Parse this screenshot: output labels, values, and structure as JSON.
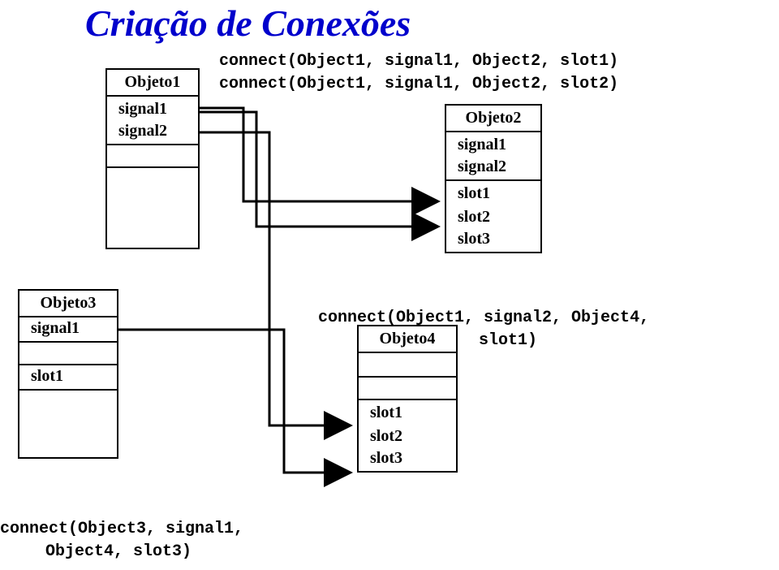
{
  "title": "Criação de Conexões",
  "code": {
    "conn1": "connect(Object1, signal1, Object2, slot1)",
    "conn2": "connect(Object1, signal1, Object2, slot2)",
    "conn3a": "connect(Object1, signal2, Object4,",
    "conn3b": "slot1)",
    "conn4a": "connect(Object3, signal1,",
    "conn4b": "Object4, slot3)"
  },
  "objeto1": {
    "name": "Objeto1",
    "sig1": "signal1",
    "sig2": "signal2"
  },
  "objeto2": {
    "name": "Objeto2",
    "sig1": "signal1",
    "sig2": "signal2",
    "slot1": "slot1",
    "slot2": "slot2",
    "slot3": "slot3"
  },
  "objeto3": {
    "name": "Objeto3",
    "sig1": "signal1",
    "slot1": "slot1"
  },
  "objeto4": {
    "name": "Objeto4",
    "slot1": "slot1",
    "slot2": "slot2",
    "slot3": "slot3"
  },
  "colors": {
    "title": "#0000cc"
  }
}
